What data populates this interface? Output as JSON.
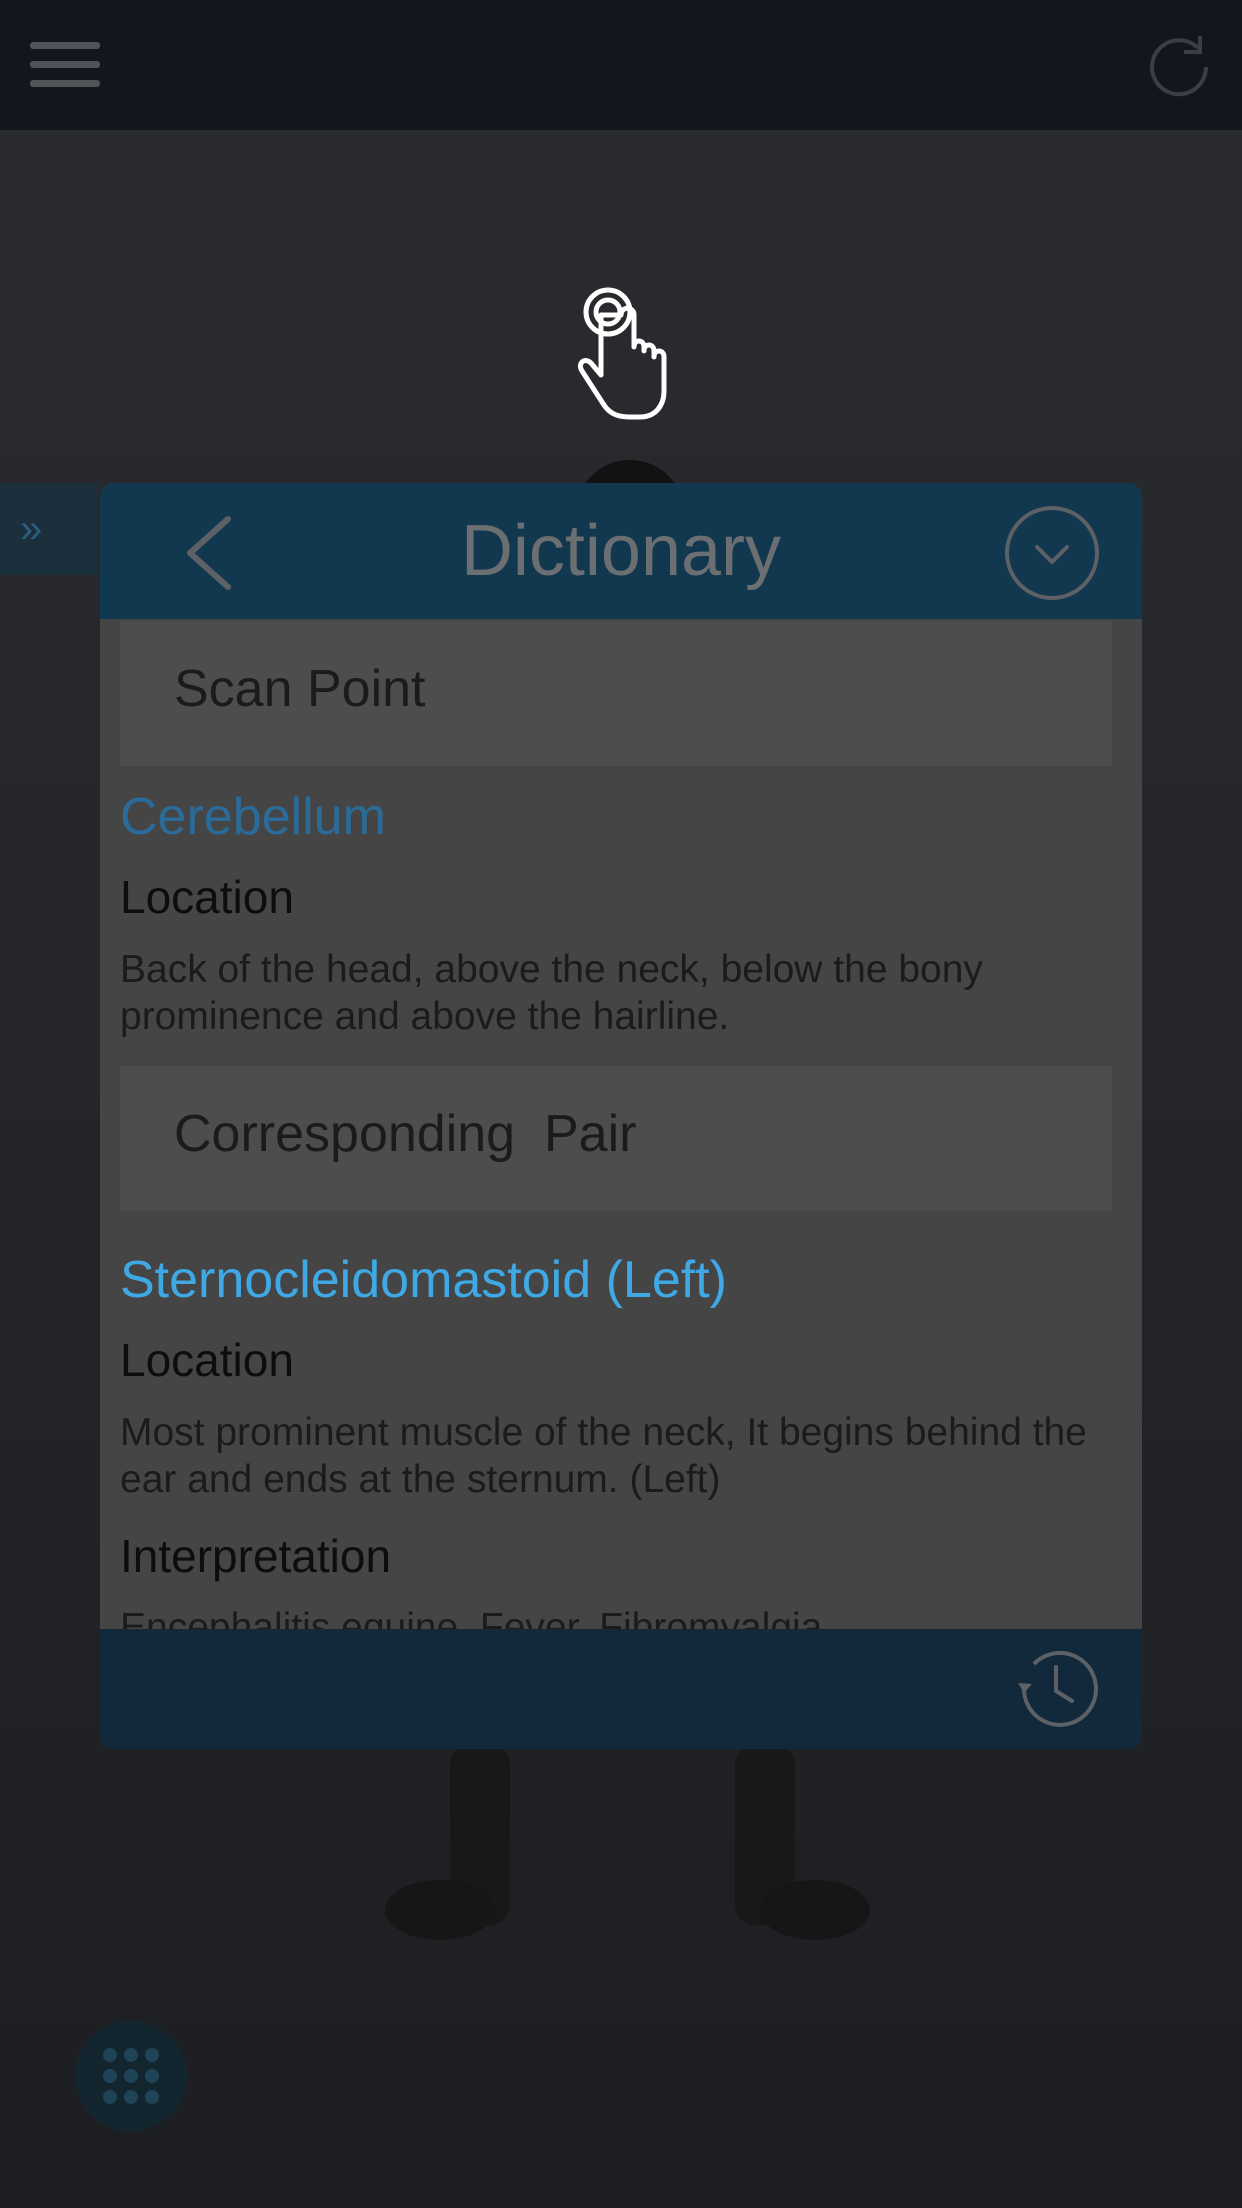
{
  "dialog": {
    "title": "Dictionary",
    "scan_point": {
      "header": "Scan Point",
      "term": "Cerebellum",
      "location_label": "Location",
      "location_text": "Back of the head, above the neck, below the bony prominence and above the hairline."
    },
    "corresponding_pair": {
      "header": "Corresponding  Pair",
      "term": "Sternocleidomastoid (Left)",
      "location_label": "Location",
      "location_text": "Most prominent muscle of the neck, It begins behind the ear and ends at the sternum. (Left)",
      "interpretation_label": "Interpretation",
      "interpretation_text": "Encephalitis equine, Fever, Fibromyalgia,"
    }
  },
  "icons": {
    "menu": "hamburger-icon",
    "refresh": "refresh-icon",
    "tap": "tap-hand-icon",
    "expand": "double-chevron-right-icon",
    "back": "chevron-left-icon",
    "collapse": "chevron-down-circle-icon",
    "history": "history-clock-icon",
    "grid": "grid-dots-icon"
  },
  "side_tab": {
    "glyph": "»"
  },
  "colors": {
    "accent_blue": "#3fa9e6",
    "header_bg": "#11384f",
    "footer_bg": "#11293b"
  }
}
